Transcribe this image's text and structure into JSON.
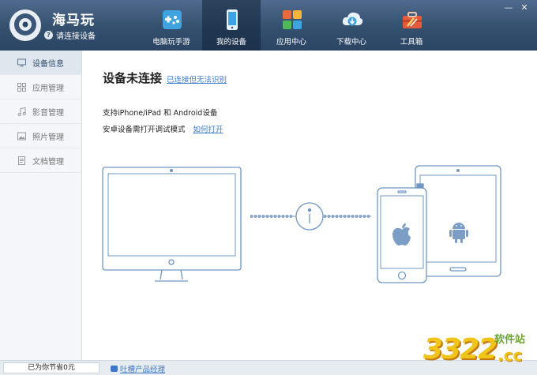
{
  "app": {
    "name": "海马玩",
    "connect_status": "请连接设备"
  },
  "nav": {
    "tabs": [
      {
        "label": "电脑玩手游",
        "icon": "gamepad-icon"
      },
      {
        "label": "我的设备",
        "icon": "phone-icon",
        "active": true
      },
      {
        "label": "应用中心",
        "icon": "app-grid-icon"
      },
      {
        "label": "下载中心",
        "icon": "cloud-download-icon"
      },
      {
        "label": "工具箱",
        "icon": "toolbox-icon"
      }
    ]
  },
  "window_controls": {
    "minimize": "—",
    "close": "✕"
  },
  "sidebar": {
    "items": [
      {
        "label": "设备信息",
        "icon": "monitor-icon",
        "active": true
      },
      {
        "label": "应用管理",
        "icon": "grid-icon"
      },
      {
        "label": "影音管理",
        "icon": "music-note-icon"
      },
      {
        "label": "照片管理",
        "icon": "image-icon"
      },
      {
        "label": "文档管理",
        "icon": "document-icon"
      }
    ]
  },
  "main": {
    "title": "设备未连接",
    "title_link": "已连接但无法识别",
    "support_text": "支持iPhone/iPad 和 Android设备",
    "debug_text": "安卓设备需打开调试模式",
    "debug_link": "如何打开"
  },
  "footer": {
    "saved_text": "已为你节省0元",
    "feedback_link": "吐槽产品经理"
  },
  "watermark": {
    "digits": "3322",
    "site": "软件站",
    "domain": ".cc"
  },
  "colors": {
    "header_top": "#4f6a8c",
    "header_bottom": "#2b4563",
    "link": "#3a7bc8",
    "illustration_line": "#6f96c2"
  }
}
